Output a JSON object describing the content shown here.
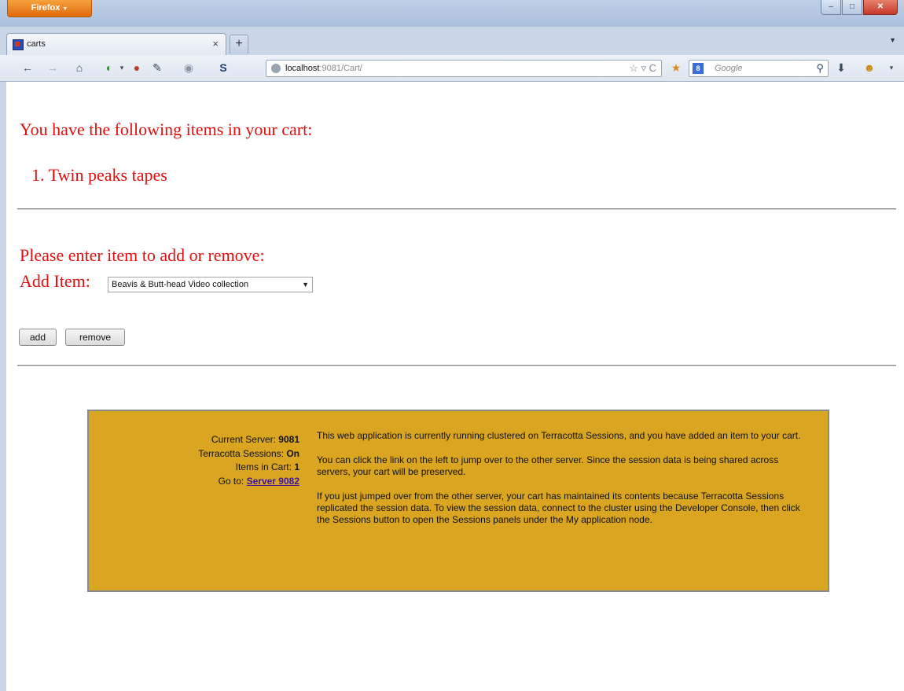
{
  "window": {
    "menu_button": "Firefox",
    "menu_button_arrow": "▼",
    "minimize": "–",
    "maximize": "□",
    "close": "✕"
  },
  "tabs": [
    {
      "title": "carts",
      "close": "×"
    }
  ],
  "new_tab": "+",
  "tab_list_arrow": "▼",
  "navbar": {
    "url_host": "localhost",
    "url_rest": ":9081/Cart/",
    "url_right_icons": "☆ ▿ C",
    "search_engine_icon": "8",
    "search_placeholder": "Google",
    "icons": [
      "back-arrow-icon",
      "forward-arrow-icon",
      "home-icon",
      "addon-icon",
      "download-icon",
      "profile-icon"
    ]
  },
  "page": {
    "heading": "You have the following items in your cart:",
    "cart_items": [
      {
        "number": "1.",
        "name": "Twin peaks tapes"
      }
    ],
    "prompt": "Please enter item to add or remove:",
    "add_item_label": "Add Item:",
    "select_value": "Beavis & Butt-head Video collection",
    "add_button": "add",
    "remove_button": "remove",
    "text_color": "#e01010"
  },
  "info": {
    "current_server_label": "Current Server:",
    "current_server_value": "9081",
    "sessions_label": "Terracotta Sessions:",
    "sessions_value": "On",
    "items_label": "Items in Cart:",
    "items_value": "1",
    "goto_label": "Go to:",
    "goto_link": "Server 9082",
    "para1": "This web application is currently running clustered on Terracotta Sessions, and you have added an item to your cart.",
    "para2": "You can click the link on the left to jump over to the other server.  Since the session data is being shared across servers, your cart will be preserved.",
    "para3": "If you just jumped over from the other server, your cart has maintained its contents because Terracotta Sessions replicated the session data. To view the session data, connect to the cluster using the Developer Console, then click the Sessions button to open the Sessions panels under the My application node.",
    "background_color": "#daa520"
  }
}
